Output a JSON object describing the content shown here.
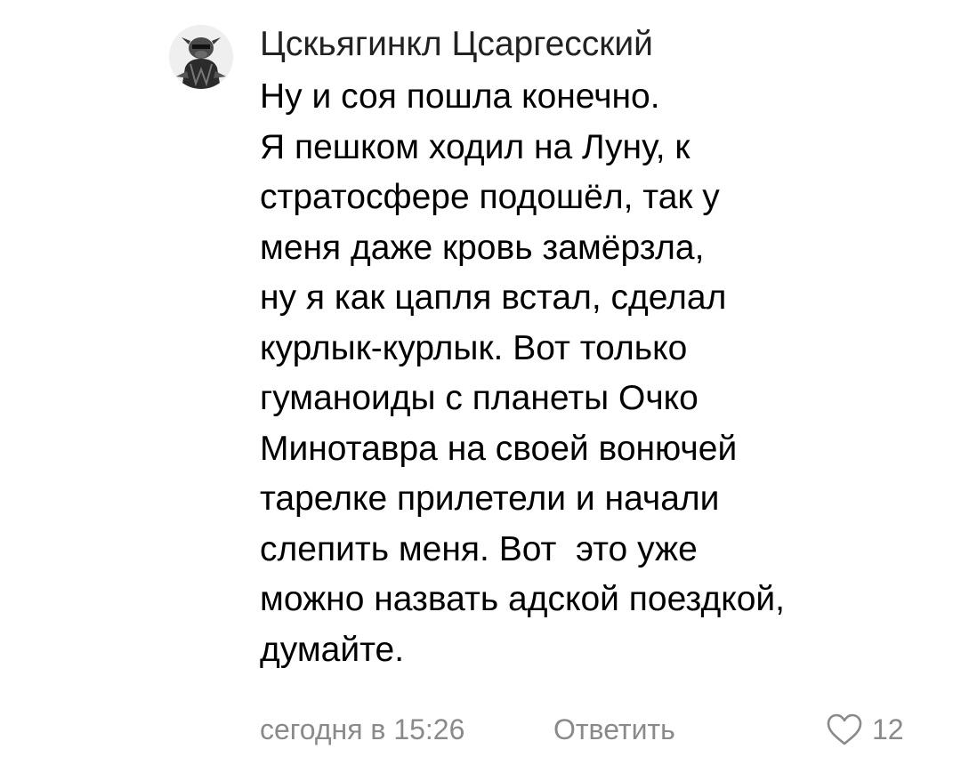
{
  "comment": {
    "author": "Цскьягинкл Цсаргесский",
    "avatar_icon": "avatar-image",
    "lines": [
      "Ну и соя пошла конечно.",
      "Я пешком ходил на Луну, к",
      "стратосфере подошёл, так у",
      "меня даже кровь замёрзла,",
      "ну я как цапля встал, сделал",
      "курлык-курлык. Вот только",
      "гуманоиды с планеты Очко",
      "Минотавра на своей вонючей",
      "тарелке прилетели и начали",
      "слепить меня. Вот  это уже",
      "можно назвать адской поездкой,",
      "думайте."
    ],
    "timestamp": "сегодня в 15:26",
    "reply_label": "Ответить",
    "like_icon": "heart-outline-icon",
    "like_count": "12"
  },
  "colors": {
    "text": "#000000",
    "meta": "#8a8a8a",
    "background": "#ffffff"
  }
}
